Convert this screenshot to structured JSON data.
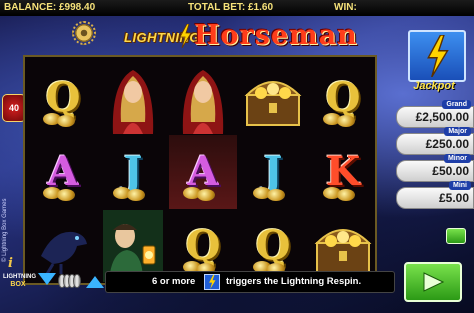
{
  "topbar": {
    "balance": "BALANCE: £998.40",
    "total_bet": "TOTAL BET: £1.60",
    "win": "WIN:"
  },
  "logo": {
    "small": "LIGHTNING",
    "big": "Horseman"
  },
  "side": {
    "lines_badge": "40",
    "copyright": "© Lightning Box Games"
  },
  "reels": [
    [
      "Q",
      "A",
      ""
    ],
    [
      "woman",
      "J",
      "man-lantern"
    ],
    [
      "woman",
      "A",
      "Q"
    ],
    [
      "chest",
      "J",
      "Q"
    ],
    [
      "Q",
      "K",
      "chest"
    ]
  ],
  "jackpot": {
    "title": "Jackpot",
    "tiers": [
      {
        "label": "Grand",
        "value": "£2,500.00"
      },
      {
        "label": "Major",
        "value": "£250.00"
      },
      {
        "label": "Minor",
        "value": "£50.00"
      },
      {
        "label": "Mini",
        "value": "£5.00"
      }
    ]
  },
  "bottom": {
    "info": "i",
    "brand_line1": "LIGHTNING",
    "brand_line2": "BOX",
    "message_prefix": "6 or more",
    "message_suffix": "triggers the Lightning Respin."
  },
  "colors": {
    "gold": "#f6e27a",
    "jackpot_blue": "#1e3ea8",
    "spin_green": "#2c9a16",
    "bolt_yellow": "#ffd400"
  },
  "icons": {
    "gear": "gear-icon",
    "bolt": "lightning-bolt-icon",
    "spin": "play-arrow-icon",
    "bet_down": "triangle-down-icon",
    "bet_up": "triangle-up-icon"
  }
}
